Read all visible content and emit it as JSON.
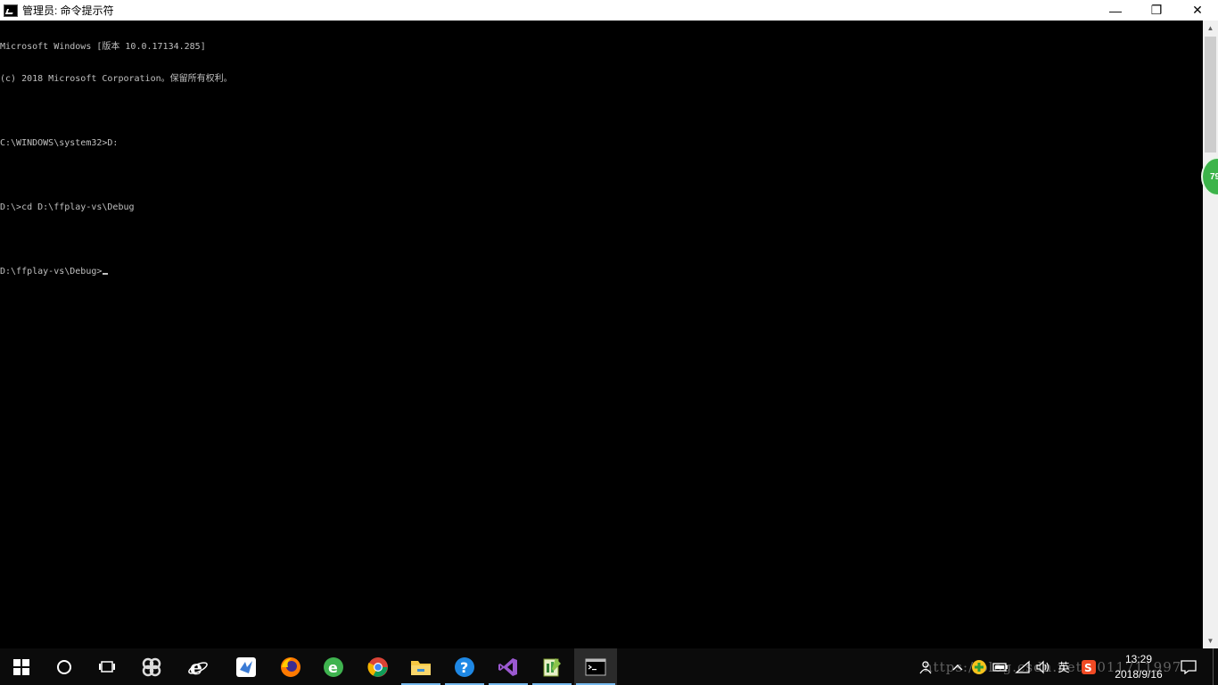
{
  "window": {
    "title": "管理员: 命令提示符",
    "minimize_glyph": "—",
    "restore_glyph": "❐",
    "close_glyph": "✕"
  },
  "console": {
    "lines": [
      "Microsoft Windows [版本 10.0.17134.285]",
      "(c) 2018 Microsoft Corporation。保留所有权利。",
      "",
      "C:\\WINDOWS\\system32>D:",
      "",
      "D:\\>cd D:\\ffplay-vs\\Debug",
      "",
      "D:\\ffplay-vs\\Debug>"
    ]
  },
  "float_widget": {
    "text": "79"
  },
  "taskbar": {
    "apps": [
      {
        "icon": "start-windows-icon"
      },
      {
        "icon": "cortana-search-icon"
      },
      {
        "icon": "task-view-icon"
      },
      {
        "icon": "app-pinwheel-icon"
      },
      {
        "icon": "internet-explorer-icon"
      },
      {
        "icon": "app-bird-icon"
      },
      {
        "icon": "firefox-icon"
      },
      {
        "icon": "app-green-e-icon"
      },
      {
        "icon": "chrome-icon"
      },
      {
        "icon": "file-explorer-icon"
      },
      {
        "icon": "help-icon"
      },
      {
        "icon": "visual-studio-icon"
      },
      {
        "icon": "notepad-plus-plus-icon"
      },
      {
        "icon": "command-prompt-icon"
      }
    ],
    "tray": {
      "ime": "英",
      "watermark": "https://blog.csdn.net/u011711997",
      "time": "13:29",
      "date": "2018/9/16"
    }
  },
  "colors": {
    "console_bg": "#000000",
    "console_text": "#c0c0c0",
    "taskbar_bg": "#0b0b0b",
    "accent": "#76b9ed"
  }
}
